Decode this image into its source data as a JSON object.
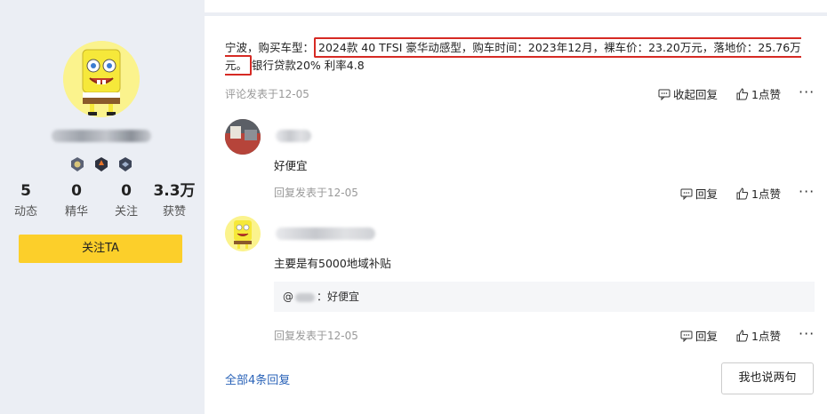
{
  "profile": {
    "stats": [
      {
        "value": "5",
        "label": "动态"
      },
      {
        "value": "0",
        "label": "精华"
      },
      {
        "value": "0",
        "label": "关注"
      },
      {
        "value": "3.3万",
        "label": "获赞"
      }
    ],
    "follow_label": "关注TA"
  },
  "comment": {
    "prefix": "宁波，购买车型：",
    "highlight": "2024款 40 TFSI 豪华动感型，购车时间：2023年12月，裸车价：23.20万元，落地价：25.76万元。",
    "suffix": "银行贷款20% 利率4.8",
    "meta": "评论发表于12-05",
    "collect_reply": "收起回复",
    "like": "1点赞",
    "more": "···"
  },
  "replies": [
    {
      "text": "好便宜",
      "meta": "回复发表于12-05",
      "reply": "回复",
      "like": "1点赞",
      "more": "···"
    },
    {
      "text": "主要是有5000地域补贴",
      "quote_prefix": "@",
      "quote_text": "：好便宜",
      "meta": "回复发表于12-05",
      "reply": "回复",
      "like": "1点赞",
      "more": "···"
    }
  ],
  "footer": {
    "all_replies": "全部4条回复",
    "say_button": "我也说两句"
  },
  "colors": {
    "accent_yellow": "#fccf2a",
    "link_blue": "#2a63b8",
    "highlight_red": "#d62a24"
  }
}
